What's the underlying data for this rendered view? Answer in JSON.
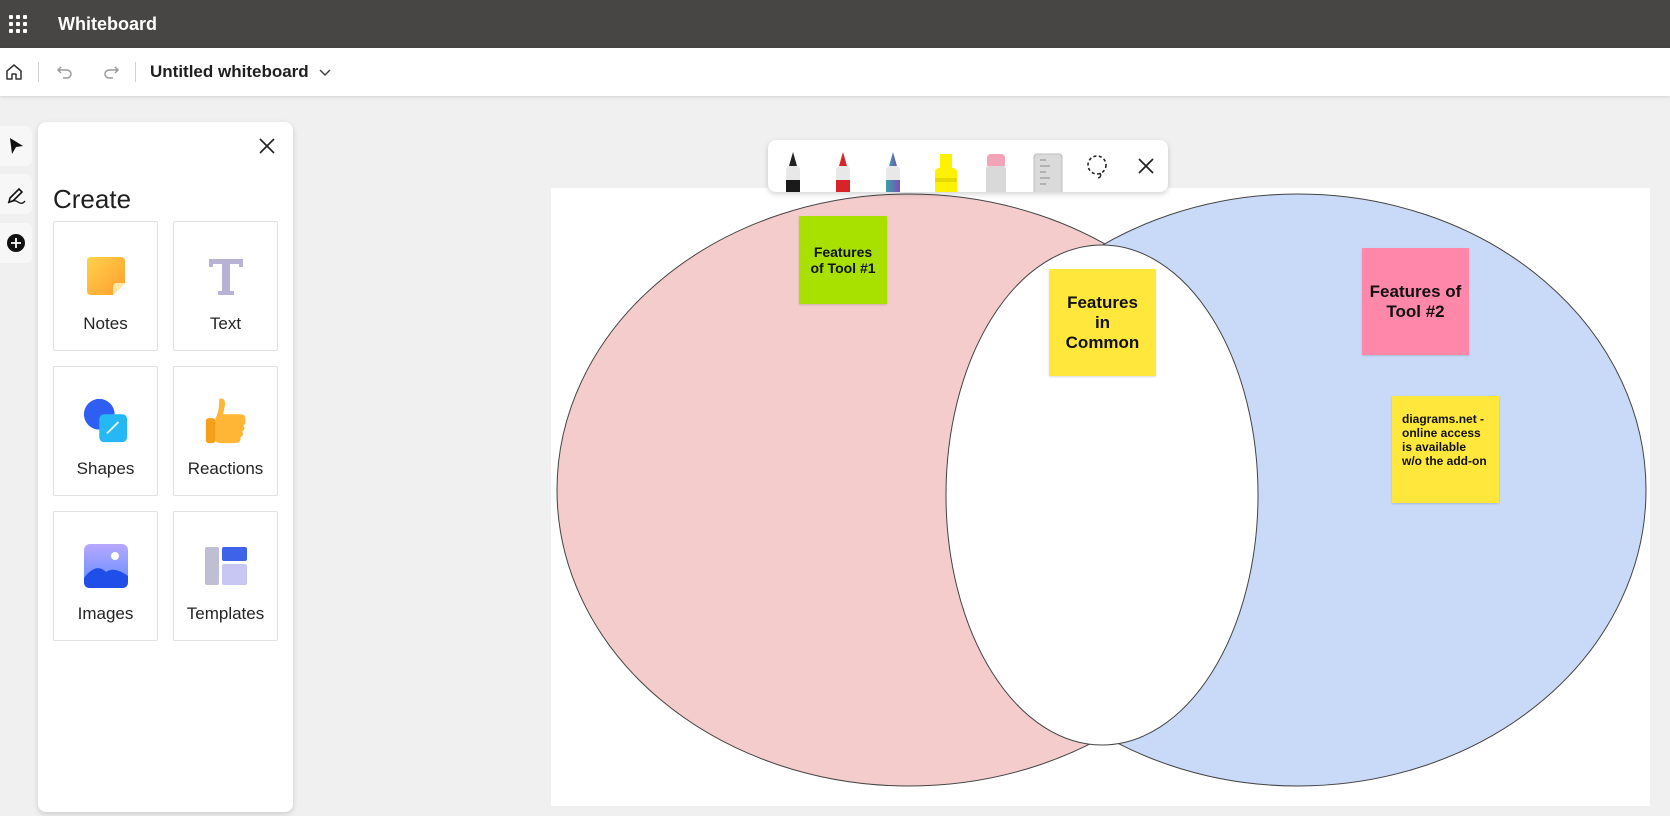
{
  "app": {
    "title": "Whiteboard"
  },
  "cmdbar": {
    "doc_title": "Untitled whiteboard"
  },
  "panel": {
    "title": "Create",
    "tiles": [
      {
        "label": "Notes",
        "icon": "sticky-note-icon"
      },
      {
        "label": "Text",
        "icon": "text-icon"
      },
      {
        "label": "Shapes",
        "icon": "shapes-icon"
      },
      {
        "label": "Reactions",
        "icon": "thumbs-up-icon"
      },
      {
        "label": "Images",
        "icon": "image-icon"
      },
      {
        "label": "Templates",
        "icon": "templates-icon"
      }
    ]
  },
  "pen_toolbar": {
    "tools": [
      "black-pen-icon",
      "red-pen-icon",
      "galaxy-pen-icon",
      "highlighter-icon",
      "eraser-icon",
      "ruler-icon",
      "lasso-icon",
      "close-icon"
    ]
  },
  "venn": {
    "left_color": "#f4cccc",
    "right_color": "#c9daf8",
    "overlap_color": "#ffffff"
  },
  "notes": {
    "tool1": "Features of Tool #1",
    "common": "Features in Common",
    "tool2": "Features of Tool #2",
    "diagrams": "diagrams.net - online access is available w/o the add-on"
  },
  "colors": {
    "appbar": "#484644",
    "note_green": "#a8e000",
    "note_yellow": "#ffe83b",
    "note_pink": "#ff88aa"
  }
}
